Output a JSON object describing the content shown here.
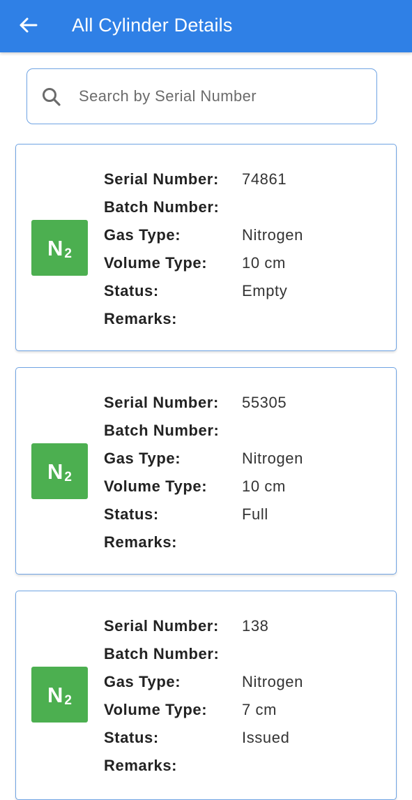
{
  "app_bar": {
    "title": "All Cylinder Details",
    "back_icon": "arrow-left-icon",
    "color": "#2f80e6"
  },
  "search": {
    "placeholder": "Search by Serial Number",
    "value": "",
    "icon": "search-icon"
  },
  "labels": {
    "serial": "Serial Number:",
    "batch": "Batch Number:",
    "gas": "Gas Type:",
    "volume": "Volume Type:",
    "status": "Status:",
    "remarks": "Remarks:"
  },
  "cylinders": [
    {
      "icon_symbol": "N",
      "icon_subscript": "2",
      "serial": "74861",
      "batch": "",
      "gas": "Nitrogen",
      "volume": "10 cm",
      "status": "Empty",
      "remarks": ""
    },
    {
      "icon_symbol": "N",
      "icon_subscript": "2",
      "serial": "55305",
      "batch": "",
      "gas": "Nitrogen",
      "volume": "10 cm",
      "status": "Full",
      "remarks": ""
    },
    {
      "icon_symbol": "N",
      "icon_subscript": "2",
      "serial": "138",
      "batch": "",
      "gas": "Nitrogen",
      "volume": "7 cm",
      "status": "Issued",
      "remarks": ""
    }
  ],
  "colors": {
    "gas_icon_bg": "#4caf50",
    "card_border": "#6fa3e3"
  }
}
